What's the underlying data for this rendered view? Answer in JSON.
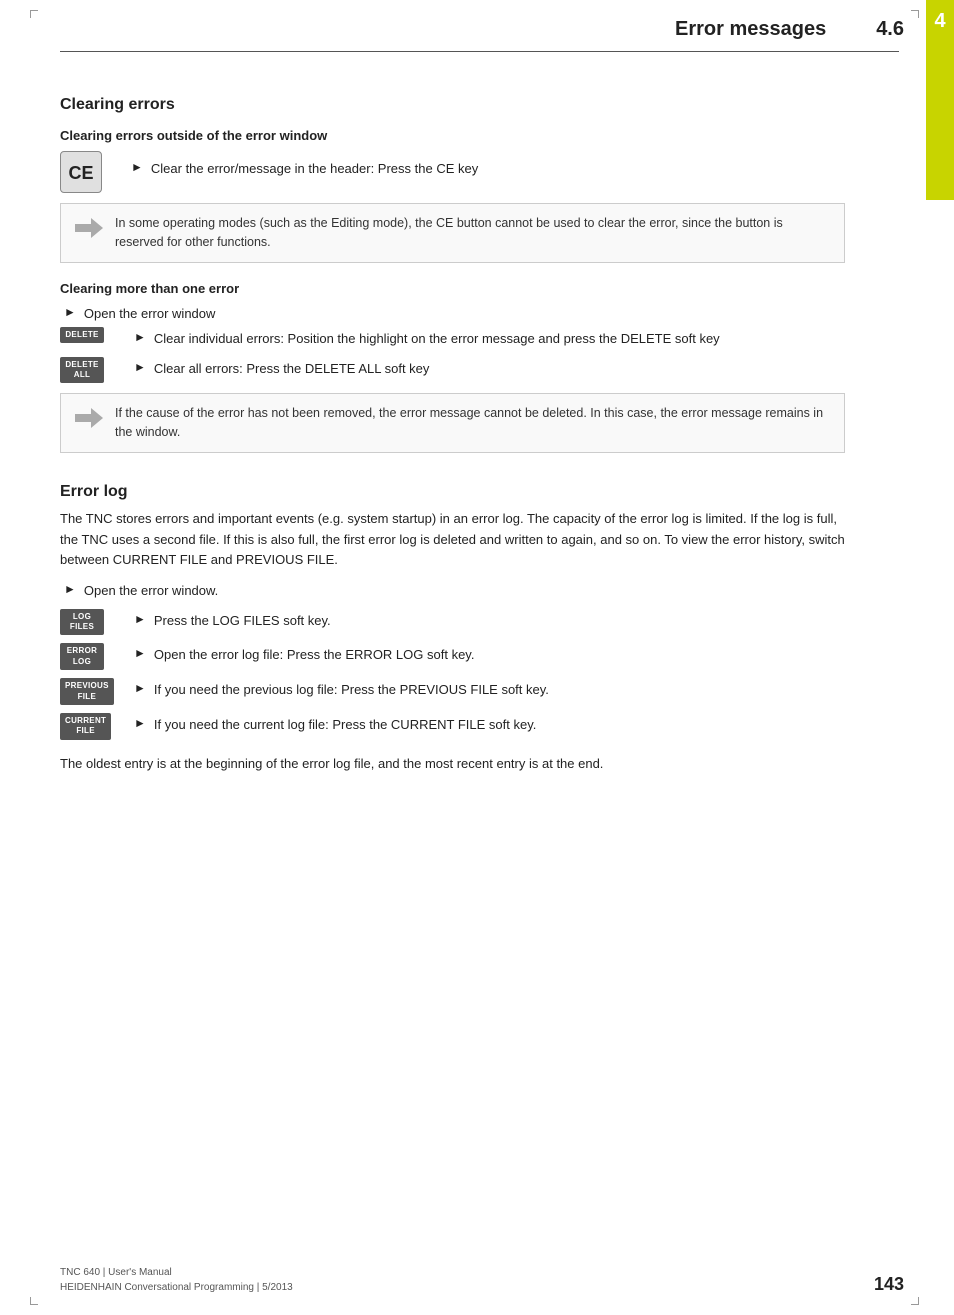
{
  "page": {
    "chapter_number": "4",
    "header_title": "Error messages",
    "header_section": "4.6",
    "footer_line1": "TNC 640 | User's Manual",
    "footer_line2": "HEIDENHAIN Conversational Programming | 5/2013",
    "footer_page": "143"
  },
  "clearing_errors": {
    "section_title": "Clearing errors",
    "subsection1_title": "Clearing errors outside of the error window",
    "ce_key_label": "CE",
    "ce_instruction": "Clear the error/message in the header: Press the CE key",
    "info_box1": "In some operating modes (such as the Editing mode), the CE button cannot be used to clear the error, since the button is reserved for other functions.",
    "subsection2_title": "Clearing more than one error",
    "open_error_window": "Open the error window",
    "delete_key_label": "DELETE",
    "delete_instruction": "Clear individual errors: Position the highlight on the error message and press the DELETE soft key",
    "delete_all_key_line1": "DELETE",
    "delete_all_key_line2": "ALL",
    "delete_all_instruction": "Clear all errors: Press the DELETE ALL soft key",
    "info_box2": "If the cause of the error has not been removed, the error message cannot be deleted. In this case, the error message remains in the window."
  },
  "error_log": {
    "section_title": "Error log",
    "body_text": "The TNC stores errors and important events (e.g. system startup) in an error log. The capacity of the error log is limited. If the log is full, the TNC uses a second file. If this is also full, the first error log is deleted and written to again, and so on. To view the error history, switch between CURRENT FILE and PREVIOUS FILE.",
    "open_instruction": "Open the error window.",
    "log_files_key_line1": "LOG",
    "log_files_key_line2": "FILES",
    "log_files_instruction": "Press the LOG FILES soft key.",
    "error_log_key_line1": "ERROR",
    "error_log_key_line2": "LOG",
    "error_log_instruction": "Open the error log file: Press the ERROR LOG soft key.",
    "previous_file_key_line1": "PREVIOUS",
    "previous_file_key_line2": "FILE",
    "previous_file_instruction": "If you need the previous log file: Press the PREVIOUS FILE soft key.",
    "current_file_key_line1": "CURRENT",
    "current_file_key_line2": "FILE",
    "current_file_instruction": "If you need the current log file: Press the CURRENT FILE soft key.",
    "footer_note": "The oldest entry is at the beginning of the error log file, and the most recent entry is at the end."
  }
}
